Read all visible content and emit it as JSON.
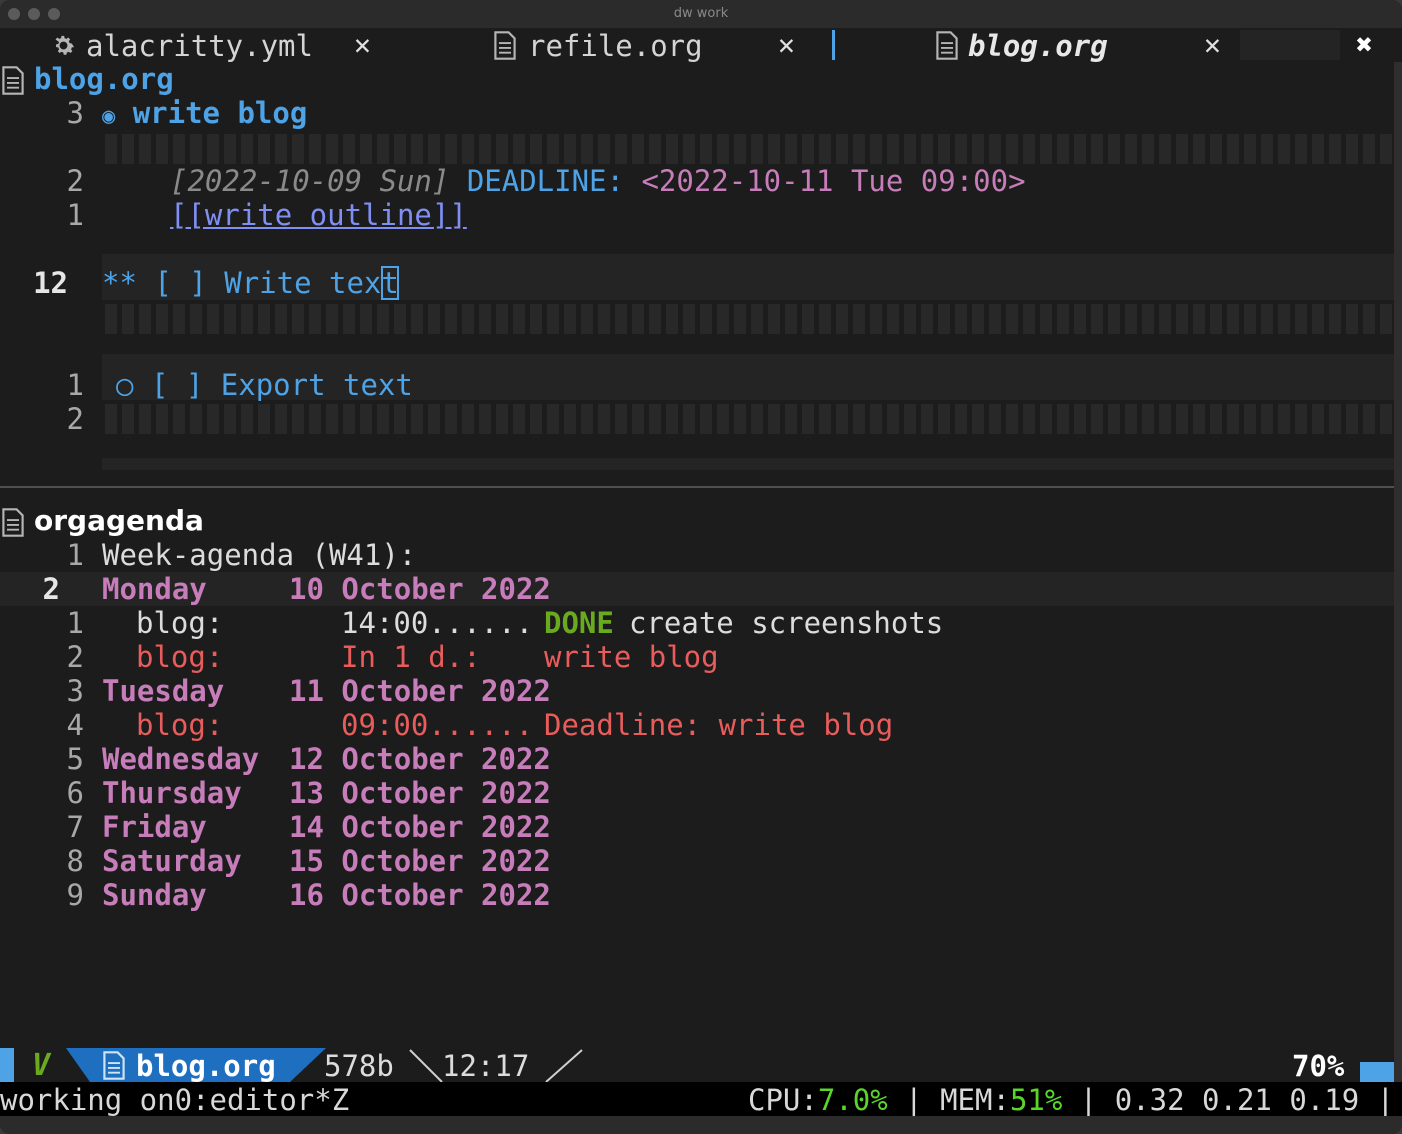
{
  "window": {
    "title": "dw work"
  },
  "tabs": [
    {
      "icon": "gear-icon",
      "label": "alacritty.yml",
      "close": "✕"
    },
    {
      "icon": "file-icon",
      "label": "refile.org",
      "close": "✕"
    },
    {
      "icon": "file-icon",
      "label": "blog.org",
      "close": "✕"
    }
  ],
  "tabbar": {
    "close_all": "✖"
  },
  "editor": {
    "buffer_name": "blog.org",
    "heading": {
      "number": "3",
      "bullet": "◉",
      "text": "write blog"
    },
    "line_a": {
      "number": "2",
      "timestamp": "[2022-10-09 Sun]",
      "keyword": "DEADLINE:",
      "date": "<2022-10-11 Tue 09:00>"
    },
    "line_b": {
      "number": "1",
      "link": "[[write outline]]"
    },
    "current": {
      "number": "12",
      "stars": "**",
      "checkbox": "[ ]",
      "text_before_cursor": "Write tex",
      "cursor_char": "t"
    },
    "item": {
      "number": "1",
      "bullet": "○",
      "checkbox": "[ ]",
      "text": "Export text"
    },
    "last_line": {
      "number": "2"
    }
  },
  "agenda": {
    "buffer_name": "orgagenda",
    "header": {
      "number": "1",
      "text": "Week-agenda (W41):"
    },
    "rows": [
      {
        "number": "2",
        "day": "Monday",
        "date": "10 October 2022",
        "current": true
      },
      {
        "number": "1",
        "entry": "blog:",
        "time": "14:00......",
        "state": "DONE",
        "text": "create screenshots",
        "style": "normal"
      },
      {
        "number": "2",
        "entry": "blog:",
        "time": "In 1 d.:",
        "text": "write blog",
        "style": "warn"
      },
      {
        "number": "3",
        "day": "Tuesday",
        "date": "11 October 2022"
      },
      {
        "number": "4",
        "entry": "blog:",
        "time": "09:00......",
        "text": "Deadline: write blog",
        "style": "deadline"
      },
      {
        "number": "5",
        "day": "Wednesday",
        "date": "12 October 2022"
      },
      {
        "number": "6",
        "day": "Thursday",
        "date": "13 October 2022"
      },
      {
        "number": "7",
        "day": "Friday",
        "date": "14 October 2022"
      },
      {
        "number": "8",
        "day": "Saturday",
        "date": "15 October 2022"
      },
      {
        "number": "9",
        "day": "Sunday",
        "date": "16 October 2022"
      }
    ]
  },
  "modeline": {
    "mode_icon": "V",
    "buffer": "blog.org",
    "size": "578b",
    "position": "12:17",
    "percent": "70%"
  },
  "echo": {
    "session": "working on0:editor*Z",
    "cpu_label": "CPU:",
    "cpu_value": "7.0%",
    "mem_label": "MEM:",
    "mem_value": "51%",
    "load": "0.32 0.21 0.19",
    "sep": "|"
  },
  "colors": {
    "accent_blue": "#4ea3e6",
    "pink": "#c77dba",
    "done_green": "#6aaa1e",
    "red": "#e85c5c",
    "status_green": "#59d629"
  }
}
